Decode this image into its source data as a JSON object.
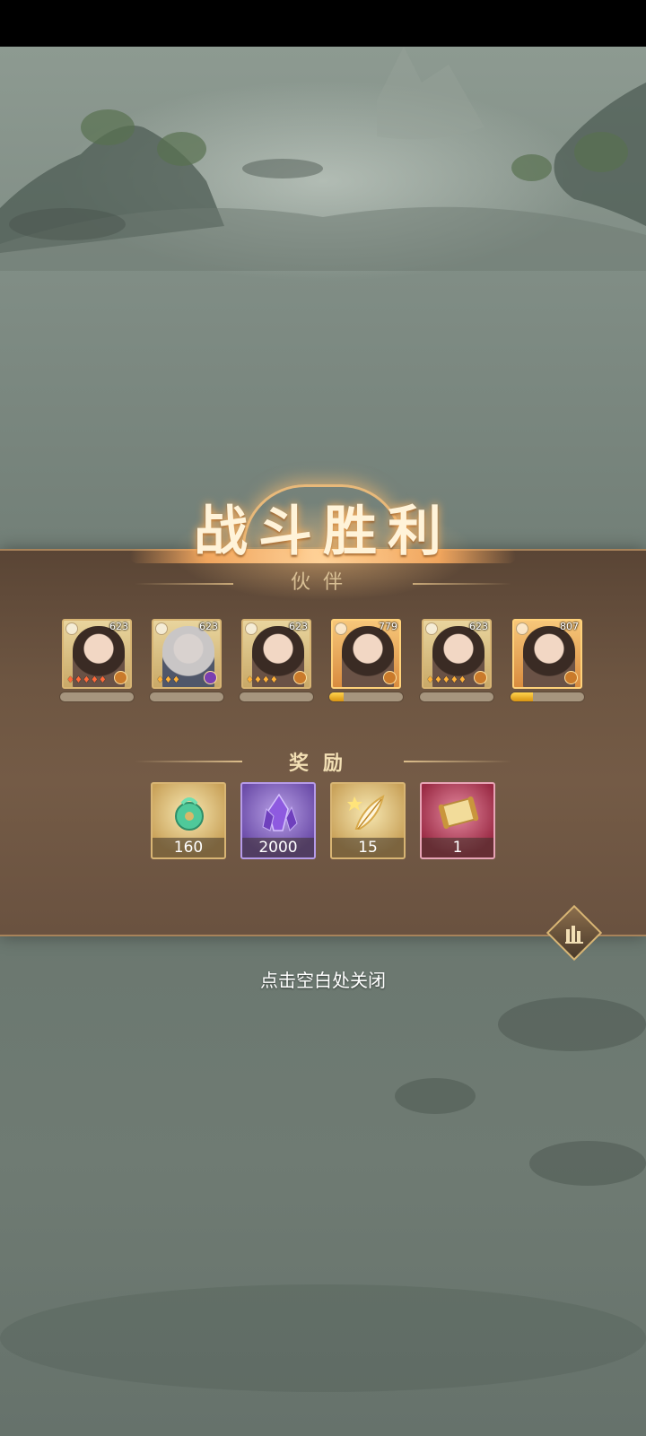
{
  "banner": {
    "title": "战斗胜利",
    "subtitle": "伙伴"
  },
  "heroes": [
    {
      "level": "623",
      "stars": "♦♦♦♦♦",
      "progress": 0
    },
    {
      "level": "623",
      "stars": "♦♦♦",
      "progress": 0
    },
    {
      "level": "623",
      "stars": "♦♦♦♦",
      "progress": 0
    },
    {
      "level": "779",
      "stars": "",
      "progress": 0.2
    },
    {
      "level": "623",
      "stars": "♦♦♦♦♦",
      "progress": 0
    },
    {
      "level": "807",
      "stars": "",
      "progress": 0.3
    }
  ],
  "rewards_section": {
    "title": "奖励",
    "items": [
      {
        "name": "jade-pendant-icon",
        "count": "160",
        "tier": "gold"
      },
      {
        "name": "purple-crystal-icon",
        "count": "2000",
        "tier": "purple"
      },
      {
        "name": "golden-feather-icon",
        "count": "15",
        "tier": "gold"
      },
      {
        "name": "scroll-icon",
        "count": "1",
        "tier": "red"
      }
    ]
  },
  "footer": {
    "close_hint": "点击空白处关闭"
  },
  "colors": {
    "panel": "#6e5642",
    "accent_gold": "#d8b574",
    "title_glow": "#ffb25e",
    "progress_fill": "#ffd34d"
  }
}
